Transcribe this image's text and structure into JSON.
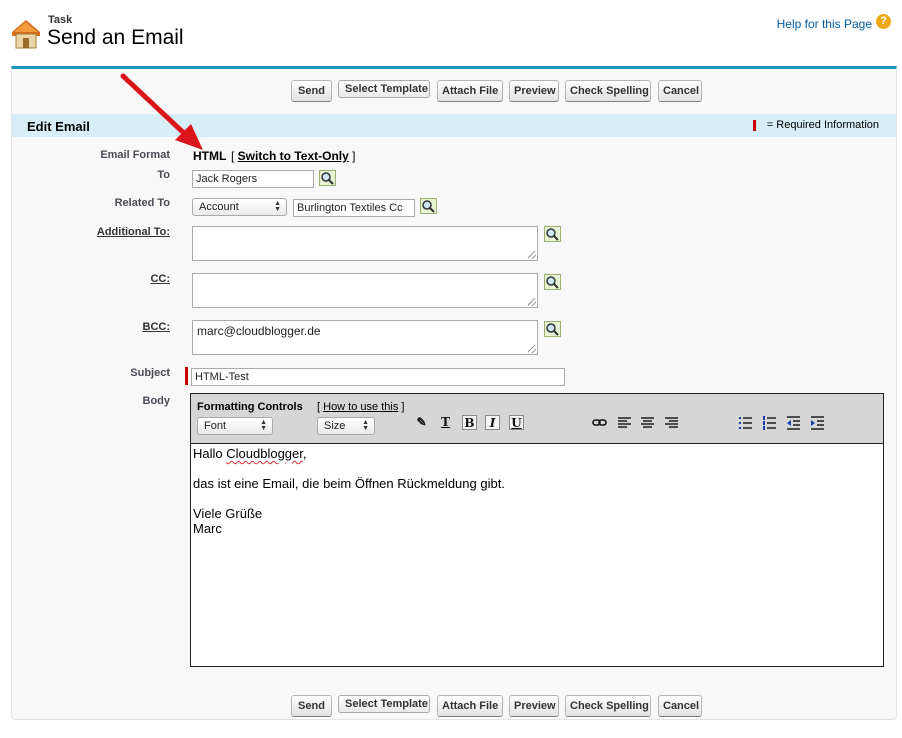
{
  "header": {
    "object_label": "Task",
    "title": "Send an Email",
    "help_link": "Help for this Page",
    "help_icon_glyph": "?"
  },
  "buttons": {
    "send": "Send",
    "select_template": "Select Template",
    "attach_file": "Attach File",
    "preview": "Preview",
    "check_spelling": "Check Spelling",
    "cancel": "Cancel"
  },
  "section": {
    "title": "Edit Email",
    "required_legend": "= Required Information"
  },
  "form": {
    "email_format_label": "Email Format",
    "email_format_value": "HTML",
    "switch_prefix": "[ ",
    "switch_link": "Switch to Text-Only",
    "switch_suffix": " ]",
    "to_label": "To",
    "to_value": "Jack Rogers",
    "related_to_label": "Related To",
    "related_to_type": "Account",
    "related_to_value": "Burlington Textiles Cc",
    "additional_to_label": "Additional To:",
    "additional_to_value": "",
    "cc_label": "CC:",
    "cc_value": "",
    "bcc_label": "BCC:",
    "bcc_value": "marc@cloudblogger.de",
    "subject_label": "Subject",
    "subject_value": "HTML-Test",
    "body_label": "Body"
  },
  "editor": {
    "toolbar_title": "Formatting Controls",
    "howto_prefix": "[ ",
    "howto_link": "How to use this",
    "howto_suffix": " ]",
    "font_select": "Font",
    "size_select": "Size",
    "body_lines": {
      "greeting_word": "Hallo",
      "greeting_name": "Cloudblogger",
      "greeting_end": ",",
      "line2": "das ist eine Email, die beim Öffnen Rückmeldung gibt.",
      "line3": "Viele Grüße",
      "line4": "Marc"
    }
  },
  "colors": {
    "accent": "#1797c0",
    "section_bg": "#d7eef8",
    "required": "#cc0000",
    "annotation_arrow": "#d9141b"
  },
  "icons": {
    "task": "task-house-icon",
    "help": "help-icon",
    "lookup": "lookup-magnifier-icon",
    "arrow": "annotation-arrow-icon"
  }
}
